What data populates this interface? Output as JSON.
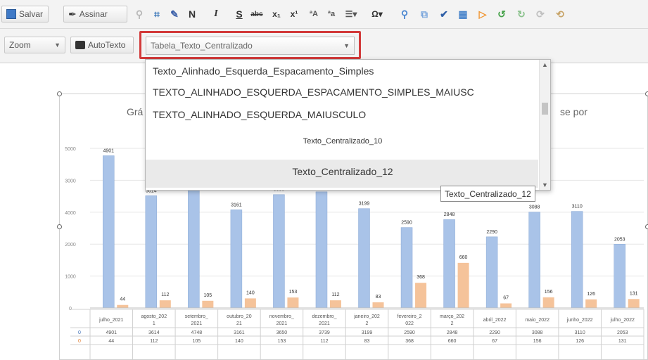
{
  "toolbar": {
    "save_label": "Salvar",
    "sign_label": "Assinar",
    "bold_label": "N",
    "italic_label": "I",
    "underline_label": "S",
    "zoom_label": "Zoom",
    "autotext_label": "AutoTexto",
    "style_select_value": "Tabela_Texto_Centralizado"
  },
  "style_dropdown": {
    "items": [
      "Texto_Alinhado_Esquerda_Espacamento_Simples",
      "TEXTO_ALINHADO_ESQUERDA_ESPACAMENTO_SIMPLES_MAIUSC",
      "TEXTO_ALINHADO_ESQUERDA_MAIUSCULO",
      "Texto_Centralizado_10",
      "Texto_Centralizado_12"
    ],
    "tooltip": "Texto_Centralizado_12"
  },
  "chart": {
    "title_left": "Grá",
    "title_right": "se por"
  },
  "chart_data": {
    "type": "bar",
    "categories": [
      "julho_2021",
      "agosto_2021",
      "setembro_2021",
      "outubro_2021",
      "novembro_2021",
      "dezembro_2021",
      "janeiro_2022",
      "fevereiro_2022",
      "março_2022",
      "abril_2022",
      "maio_2022",
      "junho_2022",
      "julho_2022"
    ],
    "category_labels": [
      [
        "julho_2021",
        ""
      ],
      [
        "agosto_202",
        "1"
      ],
      [
        "setembro_",
        "2021"
      ],
      [
        "outubro_20",
        "21"
      ],
      [
        "novembro_",
        "2021"
      ],
      [
        "dezembro_",
        "2021"
      ],
      [
        "janeiro_202",
        "2"
      ],
      [
        "fevereiro_2",
        "022"
      ],
      [
        "março_202",
        "2"
      ],
      [
        "abril_2022",
        ""
      ],
      [
        "maio_2022",
        ""
      ],
      [
        "junho_2022",
        ""
      ],
      [
        "julho_2022",
        ""
      ]
    ],
    "series": [
      {
        "values": [
          4901,
          3614,
          4748,
          3161,
          3650,
          3739,
          3199,
          2590,
          2848,
          2290,
          3088,
          3110,
          2053
        ],
        "color": "#a9c3e8"
      },
      {
        "values": [
          44,
          112,
          105,
          140,
          153,
          112,
          83,
          368,
          660,
          67,
          156,
          126,
          131
        ],
        "color": "#f5c39a"
      }
    ],
    "y_ticks": [
      "5000",
      "3000",
      "4000",
      "2000",
      "1000",
      "0"
    ],
    "ylim": [
      0,
      5500
    ],
    "table_markers": [
      "0",
      "0"
    ],
    "table_rows": [
      [
        "4901",
        "3614",
        "4748",
        "3161",
        "3650",
        "3739",
        "3199",
        "2590",
        "2848",
        "2290",
        "3088",
        "3110",
        "2053"
      ],
      [
        "44",
        "112",
        "105",
        "140",
        "153",
        "112",
        "83",
        "368",
        "660",
        "67",
        "156",
        "126",
        "131"
      ]
    ]
  }
}
